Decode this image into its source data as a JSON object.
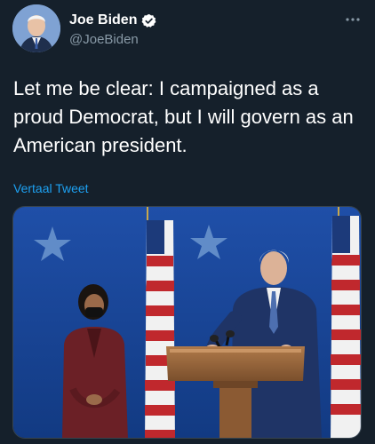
{
  "tweet": {
    "display_name": "Joe Biden",
    "handle": "@JoeBiden",
    "text": "Let me be clear: I campaigned as a proud Democrat, but I will govern as an American president.",
    "translate_label": "Vertaal Tweet"
  },
  "icons": {
    "verified": "verified-badge-icon",
    "more": "more-options-icon"
  },
  "colors": {
    "background": "#15202b",
    "link": "#1da1f2",
    "secondary_text": "#8899a6"
  }
}
